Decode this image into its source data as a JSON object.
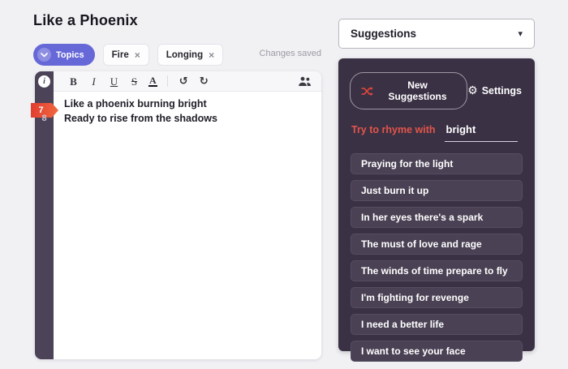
{
  "song": {
    "title": "Like a Phoenix",
    "status": "Changes saved"
  },
  "topics": {
    "button_label": "Topics",
    "remove_icon": "×",
    "tags": [
      {
        "label": "Fire"
      },
      {
        "label": "Longing"
      }
    ]
  },
  "editor": {
    "info_icon": "i",
    "toolbar": {
      "bold": "B",
      "italic": "I",
      "underline": "U",
      "strikethrough": "S",
      "text_color": "A",
      "undo": "↺",
      "redo": "↻"
    },
    "lines": [
      {
        "number": "7",
        "text": "Like a phoenix burning bright",
        "highlighted": true
      },
      {
        "number": "8",
        "text": "Ready to rise from the shadows",
        "highlighted": false
      }
    ]
  },
  "panel": {
    "dropdown_label": "Suggestions",
    "caret_icon": "▾",
    "new_suggestions_label": "New Suggestions",
    "settings_label": "Settings",
    "settings_icon": "⚙",
    "rhyme_label": "Try to rhyme with",
    "rhyme_word": "bright",
    "items": [
      "Praying for the light",
      "Just burn it up",
      "In her eyes there's a spark",
      "The must of love and rage",
      "The winds of time prepare to fly",
      "I'm fighting for revenge",
      "I need a better life",
      "I want to see your face"
    ]
  },
  "colors": {
    "page_bg": "#f1f1f4",
    "panel_bg": "#3a3145",
    "row_bg": "#4a4154",
    "gutter_bg": "#4c4358",
    "topics_pill": "#6768d8",
    "accent_red": "#e8473a",
    "marker_gradient_start": "#e23b2e",
    "marker_gradient_end": "#f06a41",
    "rhyme_label_color": "#e25549"
  }
}
